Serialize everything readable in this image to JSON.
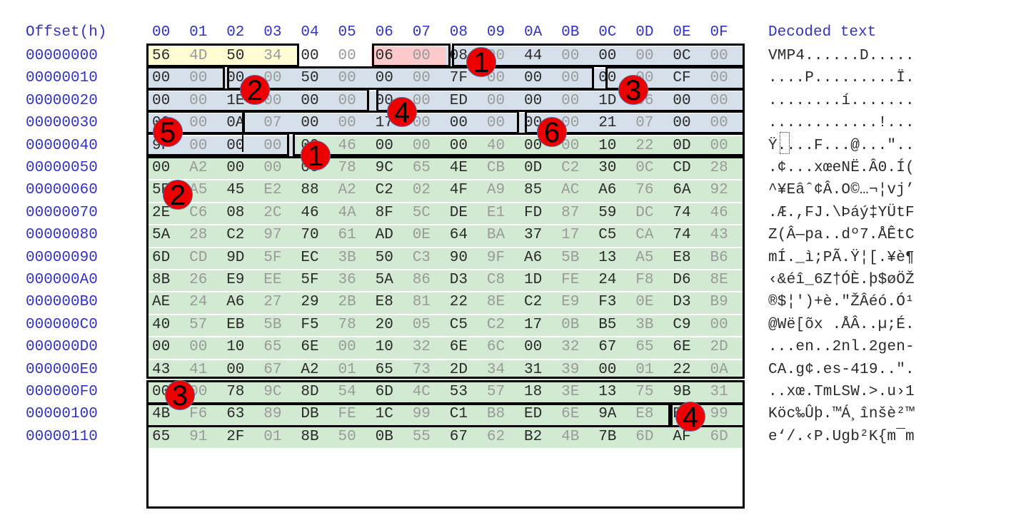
{
  "header": {
    "offset_label": "Offset(h)",
    "columns": [
      "00",
      "01",
      "02",
      "03",
      "04",
      "05",
      "06",
      "07",
      "08",
      "09",
      "0A",
      "0B",
      "0C",
      "0D",
      "0E",
      "0F"
    ],
    "decoded_label": "Decoded text"
  },
  "rows": [
    {
      "offset": "00000000",
      "bytes": [
        "56",
        "4D",
        "50",
        "34",
        "00",
        "00",
        "06",
        "00",
        "08",
        "00",
        "44",
        "00",
        "00",
        "00",
        "0C",
        "00"
      ],
      "decoded": "VMP4......D....."
    },
    {
      "offset": "00000010",
      "bytes": [
        "00",
        "00",
        "00",
        "00",
        "50",
        "00",
        "00",
        "00",
        "7F",
        "00",
        "00",
        "00",
        "00",
        "00",
        "CF",
        "00"
      ],
      "decoded": "....P.........Ï."
    },
    {
      "offset": "00000020",
      "bytes": [
        "00",
        "00",
        "1E",
        "00",
        "00",
        "00",
        "00",
        "00",
        "ED",
        "00",
        "00",
        "00",
        "1D",
        "06",
        "00",
        "00"
      ],
      "decoded": "........í......."
    },
    {
      "offset": "00000030",
      "bytes": [
        "00",
        "00",
        "0A",
        "07",
        "00",
        "00",
        "17",
        "00",
        "00",
        "00",
        "00",
        "00",
        "21",
        "07",
        "00",
        "00"
      ],
      "decoded": "............!..."
    },
    {
      "offset": "00000040",
      "bytes": [
        "9F",
        "00",
        "00",
        "00",
        "00",
        "46",
        "00",
        "00",
        "00",
        "40",
        "00",
        "00",
        "10",
        "22",
        "0D",
        "00"
      ],
      "decoded": "Ÿ....F...@...\".."
    },
    {
      "offset": "00000050",
      "bytes": [
        "00",
        "A2",
        "00",
        "00",
        "00",
        "78",
        "9C",
        "65",
        "4E",
        "CB",
        "0D",
        "C2",
        "30",
        "0C",
        "CD",
        "28"
      ],
      "decoded": ".¢...xœeNË.Â0.Í("
    },
    {
      "offset": "00000060",
      "bytes": [
        "5E",
        "A5",
        "45",
        "E2",
        "88",
        "A2",
        "C2",
        "02",
        "4F",
        "A9",
        "85",
        "AC",
        "A6",
        "76",
        "6A",
        "92"
      ],
      "decoded": "^¥Eâˆ¢Â.O©…¬¦vj’"
    },
    {
      "offset": "00000070",
      "bytes": [
        "2E",
        "C6",
        "08",
        "2C",
        "46",
        "4A",
        "8F",
        "5C",
        "DE",
        "E1",
        "FD",
        "87",
        "59",
        "DC",
        "74",
        "46"
      ],
      "decoded": ".Æ.,FJ.\\Þáý‡YÜtF"
    },
    {
      "offset": "00000080",
      "bytes": [
        "5A",
        "28",
        "C2",
        "97",
        "70",
        "61",
        "AD",
        "0E",
        "64",
        "BA",
        "37",
        "17",
        "C5",
        "CA",
        "74",
        "43"
      ],
      "decoded": "Z(Â—pa..dº7.ÅÊtC"
    },
    {
      "offset": "00000090",
      "bytes": [
        "6D",
        "CD",
        "9D",
        "5F",
        "EC",
        "3B",
        "50",
        "C3",
        "90",
        "9F",
        "A6",
        "5B",
        "13",
        "A5",
        "E8",
        "B6"
      ],
      "decoded": "mÍ._ì;PÃ.Ÿ¦[.¥è¶"
    },
    {
      "offset": "000000A0",
      "bytes": [
        "8B",
        "26",
        "E9",
        "EE",
        "5F",
        "36",
        "5A",
        "86",
        "D3",
        "C8",
        "1D",
        "FE",
        "24",
        "F8",
        "D6",
        "8E"
      ],
      "decoded": "‹&éî_6Z†ÓÈ.þ$øÖŽ"
    },
    {
      "offset": "000000B0",
      "bytes": [
        "AE",
        "24",
        "A6",
        "27",
        "29",
        "2B",
        "E8",
        "81",
        "22",
        "8E",
        "C2",
        "E9",
        "F3",
        "0E",
        "D3",
        "B9"
      ],
      "decoded": "®$¦')+è.\"ŽÂéó.Ó¹"
    },
    {
      "offset": "000000C0",
      "bytes": [
        "40",
        "57",
        "EB",
        "5B",
        "F5",
        "78",
        "20",
        "05",
        "C5",
        "C2",
        "17",
        "0B",
        "B5",
        "3B",
        "C9",
        "00"
      ],
      "decoded": "@Wë[õx .ÅÂ..µ;É."
    },
    {
      "offset": "000000D0",
      "bytes": [
        "00",
        "00",
        "10",
        "65",
        "6E",
        "00",
        "10",
        "32",
        "6E",
        "6C",
        "00",
        "32",
        "67",
        "65",
        "6E",
        "2D"
      ],
      "decoded": "...en..2nl.2gen-"
    },
    {
      "offset": "000000E0",
      "bytes": [
        "43",
        "41",
        "00",
        "67",
        "A2",
        "01",
        "65",
        "73",
        "2D",
        "34",
        "31",
        "39",
        "00",
        "01",
        "22",
        "0A"
      ],
      "decoded": "CA.g¢.es-419..\"."
    },
    {
      "offset": "000000F0",
      "bytes": [
        "00",
        "00",
        "78",
        "9C",
        "8D",
        "54",
        "6D",
        "4C",
        "53",
        "57",
        "18",
        "3E",
        "13",
        "75",
        "9B",
        "31"
      ],
      "decoded": "..xœ.TmLSW.>.u›1"
    },
    {
      "offset": "00000100",
      "bytes": [
        "4B",
        "F6",
        "63",
        "89",
        "DB",
        "FE",
        "1C",
        "99",
        "C1",
        "B8",
        "ED",
        "6E",
        "9A",
        "E8",
        "B2",
        "99"
      ],
      "decoded": "Köc‰Ûþ.™Á¸înšè²™"
    },
    {
      "offset": "00000110",
      "bytes": [
        "65",
        "91",
        "2F",
        "01",
        "8B",
        "50",
        "0B",
        "55",
        "67",
        "62",
        "B2",
        "4B",
        "7B",
        "6D",
        "AF",
        "6D"
      ],
      "decoded": "e‘/.‹P.Ugb²K{m¯m"
    }
  ],
  "annotations": [
    {
      "label": "1",
      "color": "#ee0000"
    },
    {
      "label": "2",
      "color": "#ee0000"
    },
    {
      "label": "3",
      "color": "#ee0000"
    },
    {
      "label": "4",
      "color": "#ee0000"
    },
    {
      "label": "5",
      "color": "#ee0000"
    },
    {
      "label": "6",
      "color": "#ee0000"
    },
    {
      "label": "1",
      "color": "#ee0000"
    },
    {
      "label": "2",
      "color": "#ee0000"
    },
    {
      "label": "3",
      "color": "#ee0000"
    },
    {
      "label": "4",
      "color": "#ee0000"
    }
  ],
  "colors": {
    "offset_text": "#3232c8",
    "magic_highlight": "#fffbd2",
    "version_highlight": "#fccaca",
    "header_table_highlight": "#d6e0ea",
    "data_highlight": "#d2ead2",
    "annotation_badge": "#ee0000"
  }
}
